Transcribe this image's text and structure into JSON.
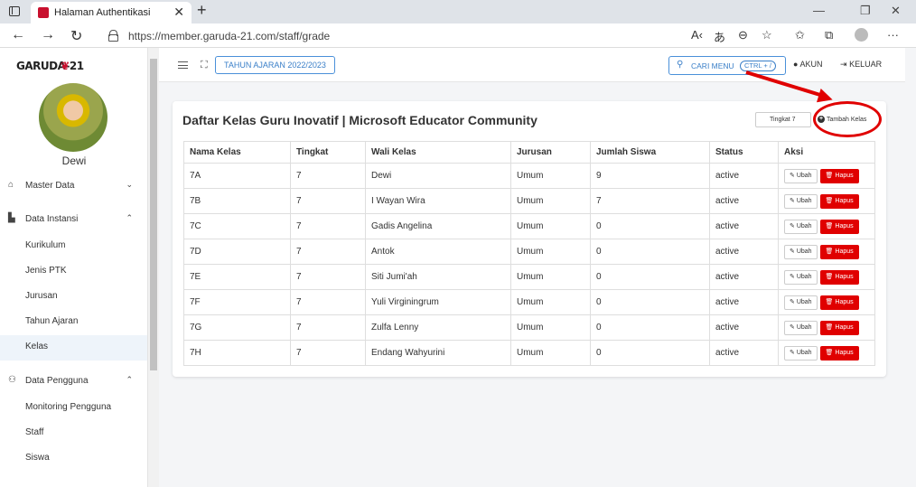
{
  "browser": {
    "tab_title": "Halaman Authentikasi",
    "tab_close": "✕",
    "new_tab": "+",
    "url": "https://member.garuda-21.com/staff/grade",
    "win_min": "—",
    "win_max": "❐",
    "win_close": "✕",
    "icons": [
      "back-icon",
      "forward-icon",
      "refresh-icon",
      "lock-icon",
      "read-aloud-icon",
      "translate-icon",
      "zoom-icon",
      "favorite-add-icon",
      "favorites-icon",
      "collections-icon",
      "profile-icon",
      "more-icon"
    ]
  },
  "sidebar": {
    "brand": "GARUDA-21",
    "user_name": "Dewi",
    "items": [
      {
        "label": "Master Data",
        "icon": "home-icon",
        "caret": "⌄"
      },
      {
        "label": "Data Instansi",
        "icon": "building-icon",
        "caret": "⌃"
      },
      {
        "label": "Kurikulum"
      },
      {
        "label": "Jenis PTK"
      },
      {
        "label": "Jurusan"
      },
      {
        "label": "Tahun Ajaran"
      },
      {
        "label": "Kelas"
      },
      {
        "label": "Data Pengguna",
        "icon": "user-icon",
        "caret": "⌃"
      },
      {
        "label": "Monitoring Pengguna"
      },
      {
        "label": "Staff"
      },
      {
        "label": "Siswa"
      }
    ]
  },
  "topbar": {
    "year_button": "TAHUN AJARAN 2022/2023",
    "search_label": "CARI MENU",
    "search_kbd": "CTRL + /",
    "akun": "AKUN",
    "keluar": "KELUAR"
  },
  "card": {
    "title": "Daftar Kelas Guru Inovatif | Microsoft Educator Community",
    "grade_select": "Tingkat 7",
    "add_button": "Tambah Kelas",
    "columns": [
      "Nama Kelas",
      "Tingkat",
      "Wali Kelas",
      "Jurusan",
      "Jumlah Siswa",
      "Status",
      "Aksi"
    ],
    "edit_label": "Ubah",
    "delete_label": "Hapus",
    "rows": [
      [
        "7A",
        "7",
        "Dewi",
        "Umum",
        "9",
        "active"
      ],
      [
        "7B",
        "7",
        "I Wayan Wira",
        "Umum",
        "7",
        "active"
      ],
      [
        "7C",
        "7",
        "Gadis Angelina",
        "Umum",
        "0",
        "active"
      ],
      [
        "7D",
        "7",
        "Antok",
        "Umum",
        "0",
        "active"
      ],
      [
        "7E",
        "7",
        "Siti Jumi'ah",
        "Umum",
        "0",
        "active"
      ],
      [
        "7F",
        "7",
        "Yuli Virginingrum",
        "Umum",
        "0",
        "active"
      ],
      [
        "7G",
        "7",
        "Zulfa Lenny",
        "Umum",
        "0",
        "active"
      ],
      [
        "7H",
        "7",
        "Endang Wahyurini",
        "Umum",
        "0",
        "active"
      ]
    ]
  },
  "colors": {
    "accent": "#3a7fc8",
    "danger": "#e00000",
    "annotation": "#e00000"
  }
}
